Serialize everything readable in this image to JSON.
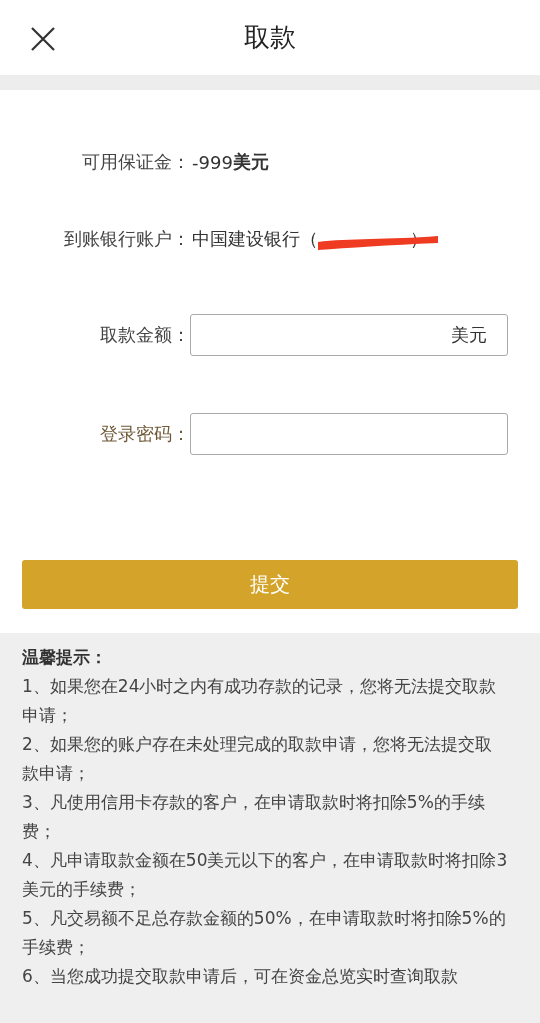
{
  "header": {
    "title": "取款"
  },
  "margin": {
    "label": "可用保证金：",
    "amount": "-999",
    "currency": "美元"
  },
  "account": {
    "label": "到账银行账户：",
    "bank": "中国建设银行（",
    "closing": "）",
    "redacted": true
  },
  "amount_field": {
    "label": "取款金额：",
    "suffix": "美元"
  },
  "password_field": {
    "label": "登录密码："
  },
  "submit": "提交",
  "notes": {
    "title": "温馨提示：",
    "items": [
      "1、如果您在24小时之内有成功存款的记录，您将无法提交取款申请；",
      "2、如果您的账户存在未处理完成的取款申请，您将无法提交取款申请；",
      "3、凡使用信用卡存款的客户，在申请取款时将扣除5%的手续费；",
      "4、凡申请取款金额在50美元以下的客户，在申请取款时将扣除3美元的手续费；",
      "5、凡交易额不足总存款金额的50%，在申请取款时将扣除5%的手续费；",
      "6、当您成功提交取款申请后，可在资金总览实时查询取款"
    ]
  }
}
